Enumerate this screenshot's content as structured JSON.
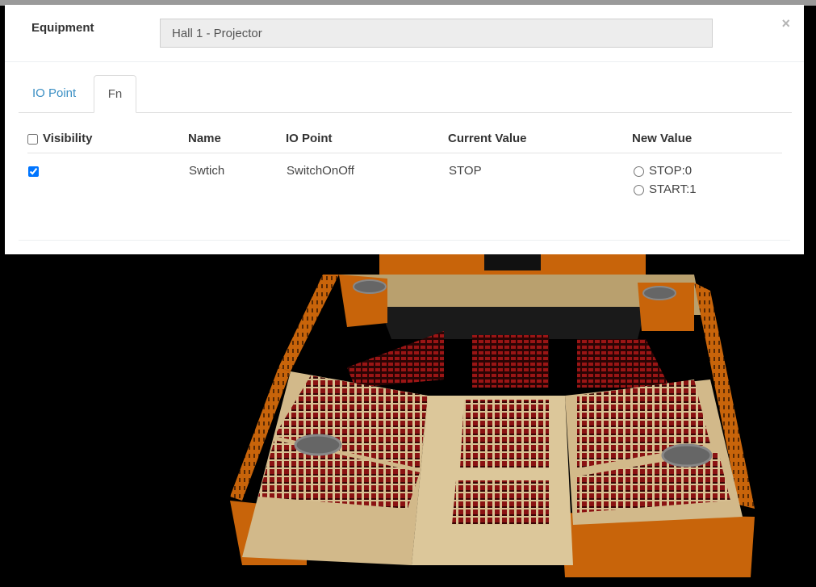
{
  "equipment": {
    "label": "Equipment",
    "value": "Hall 1 - Projector",
    "close": "×"
  },
  "tabs": [
    {
      "label": "IO Point",
      "active": false
    },
    {
      "label": "Fn",
      "active": true
    }
  ],
  "table": {
    "headers": {
      "visibility": "Visibility",
      "name": "Name",
      "io_point": "IO Point",
      "current_value": "Current Value",
      "new_value": "New Value"
    },
    "rows": [
      {
        "visible": true,
        "name": "Swtich",
        "io_point": "SwitchOnOff",
        "current_value": "STOP",
        "options": [
          "STOP:0",
          "START:1"
        ]
      }
    ]
  },
  "colors": {
    "accent": "#3b8fc4",
    "wall": "#c8640a",
    "floor": "#d2b98a",
    "seat": "#8a0f0f"
  }
}
